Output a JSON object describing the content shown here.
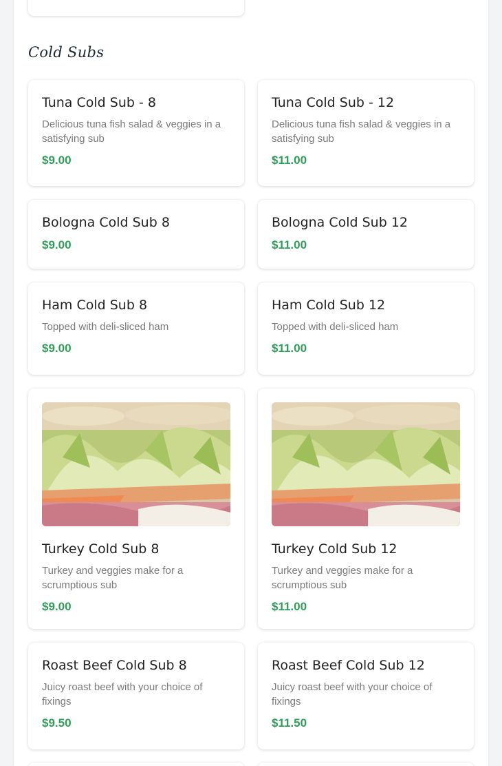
{
  "section": {
    "title": "Cold Subs"
  },
  "items": [
    {
      "name": "Tuna Cold Sub - 8",
      "description": "Delicious tuna fish salad & veggies in a satisfying sub",
      "price": "$9.00"
    },
    {
      "name": "Tuna Cold Sub - 12",
      "description": "Delicious tuna fish salad & veggies in a satisfying sub",
      "price": "$11.00"
    },
    {
      "name": "Bologna Cold Sub 8",
      "price": "$9.00"
    },
    {
      "name": "Bologna Cold Sub 12",
      "price": "$11.00"
    },
    {
      "name": "Ham Cold Sub 8",
      "description": "Topped with deli-sliced ham",
      "price": "$9.00"
    },
    {
      "name": "Ham Cold Sub 12",
      "description": "Topped with deli-sliced ham",
      "price": "$11.00"
    },
    {
      "name": "Turkey Cold Sub 8",
      "description": "Turkey and veggies make for a scrumptious sub",
      "price": "$9.00",
      "has_image": true
    },
    {
      "name": "Turkey Cold Sub 12",
      "description": "Turkey and veggies make for a scrumptious sub",
      "price": "$11.00",
      "has_image": true
    },
    {
      "name": "Roast Beef Cold Sub 8",
      "description": "Juicy roast beef with your choice of fixings",
      "price": "$9.50"
    },
    {
      "name": "Roast Beef Cold Sub 12",
      "description": "Juicy roast beef with your choice of fixings",
      "price": "$11.50"
    }
  ],
  "colors": {
    "price": "#2f9e58",
    "title": "#1e2a35"
  }
}
